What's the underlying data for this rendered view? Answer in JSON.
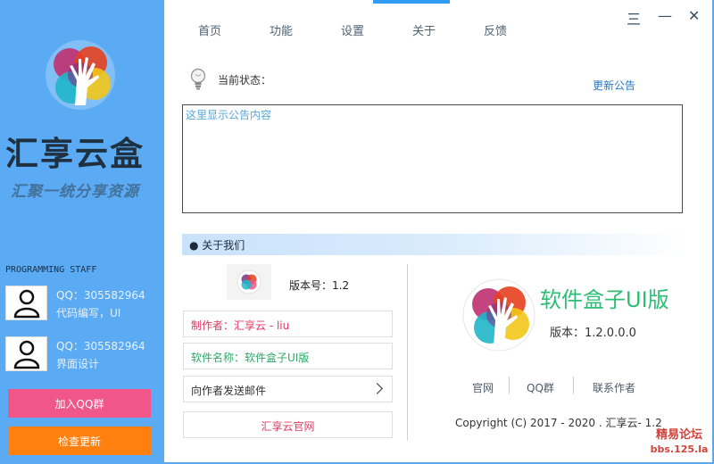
{
  "sidebar": {
    "brand_title": "汇享云盒",
    "brand_subtitle": "汇聚一统分享资源",
    "staff_title": "PROGRAMMING STAFF",
    "staff": [
      {
        "line1": "QQ：305582964",
        "line2": "代码编写，UI"
      },
      {
        "line1": "QQ：305582964",
        "line2": "界面设计"
      }
    ],
    "join_qq_label": "加入QQ群",
    "check_update_label": "检查更新"
  },
  "tabs": [
    {
      "label": "首页"
    },
    {
      "label": "功能"
    },
    {
      "label": "设置"
    },
    {
      "label": "关于"
    },
    {
      "label": "反馈"
    }
  ],
  "active_tab": "关于",
  "window_controls": {
    "menu": "三",
    "minimize": "—",
    "close": "✕"
  },
  "status": {
    "label": "当前状态：",
    "update_notice_link": "更新公告"
  },
  "notice_box": {
    "content": "这里显示公告内容"
  },
  "about": {
    "section_title": "● 关于我们",
    "version_label": "版本号：1.2",
    "author": "制作者：汇享云 - liu",
    "software_name": "软件名称：软件盒子UI版",
    "send_mail": "向作者发送邮件",
    "official_site": "汇享云官网",
    "app_name": "软件盒子UI版",
    "app_version": "版本：1.2.0.0.0",
    "links": [
      "官网",
      "QQ群",
      "联系作者"
    ],
    "copyright": "Copyright (C) 2017 - 2020 .  汇享云- 1.2"
  },
  "watermark": {
    "line1": "精易论坛",
    "line2": "bbs.125.la"
  },
  "colors": {
    "sidebar_bg": "#5aaaf4",
    "active_tab": "#2f9cf5",
    "pink_button": "#f0568a",
    "orange_button": "#ff7f0f",
    "app_name_green": "#2ebd74",
    "author_red": "#e03a64",
    "link_blue": "#2676c4"
  }
}
